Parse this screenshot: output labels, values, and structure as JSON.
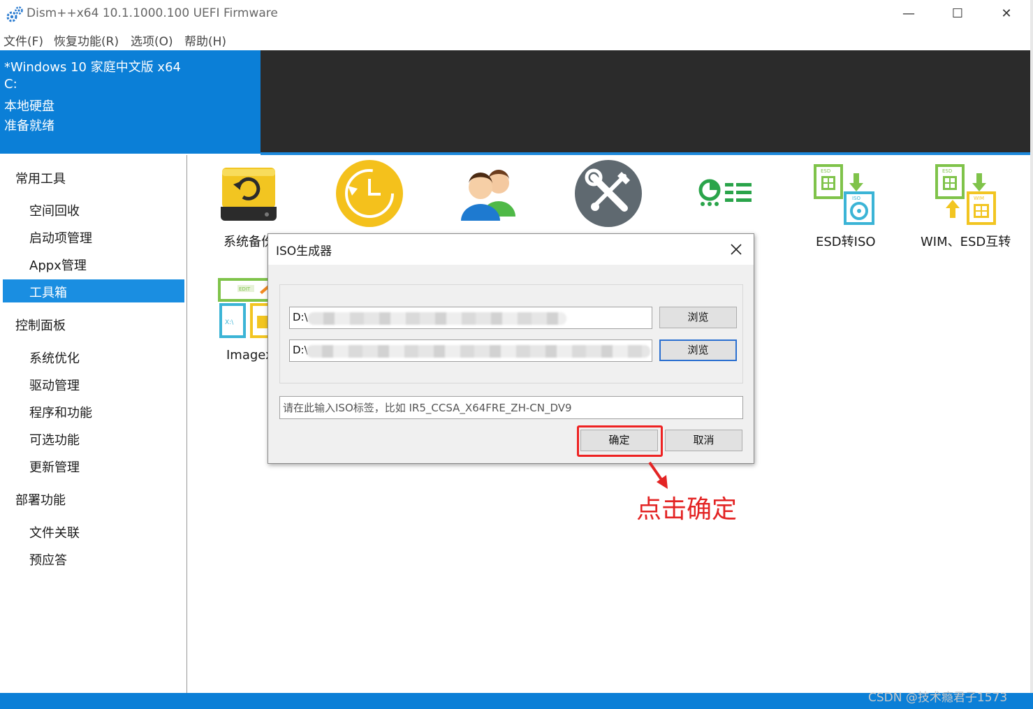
{
  "window": {
    "title": "Dism++x64 10.1.1000.100 UEFI Firmware",
    "controls": {
      "minimize": "—",
      "maximize": "☐",
      "close": "✕"
    }
  },
  "menu": [
    "文件(F)",
    "恢复功能(R)",
    "选项(O)",
    "帮助(H)"
  ],
  "info": {
    "os": "*Windows 10 家庭中文版 x64",
    "drive": "C:",
    "disk_type": "本地硬盘",
    "status": "准备就绪"
  },
  "sidebar": {
    "groups": [
      {
        "label": "常用工具",
        "items": [
          "空间回收",
          "启动项管理",
          "Appx管理",
          "工具箱"
        ]
      },
      {
        "label": "控制面板",
        "items": [
          "系统优化",
          "驱动管理",
          "程序和功能",
          "可选功能",
          "更新管理"
        ]
      },
      {
        "label": "部署功能",
        "items": [
          "文件关联",
          "预应答"
        ]
      }
    ],
    "selected": "工具箱"
  },
  "tools": {
    "row1": [
      "系统备份",
      "ESD转ISO",
      "WIM、ESD互转"
    ],
    "row2": [
      "Imagex"
    ]
  },
  "colors": {
    "accent": "#0b7fd7",
    "selected": "#1a8ee1",
    "annotation": "#e32424"
  },
  "dialog": {
    "title": "ISO生成器",
    "source_path": "D:\\",
    "target_path": "D:\\",
    "browse_label": "浏览",
    "iso_label_placeholder": "请在此输入ISO标签，比如 IR5_CCSA_X64FRE_ZH-CN_DV9",
    "ok_label": "确定",
    "cancel_label": "取消"
  },
  "annotation": {
    "text": "点击确定"
  },
  "watermark": "CSDN @技术瘾君子1573"
}
